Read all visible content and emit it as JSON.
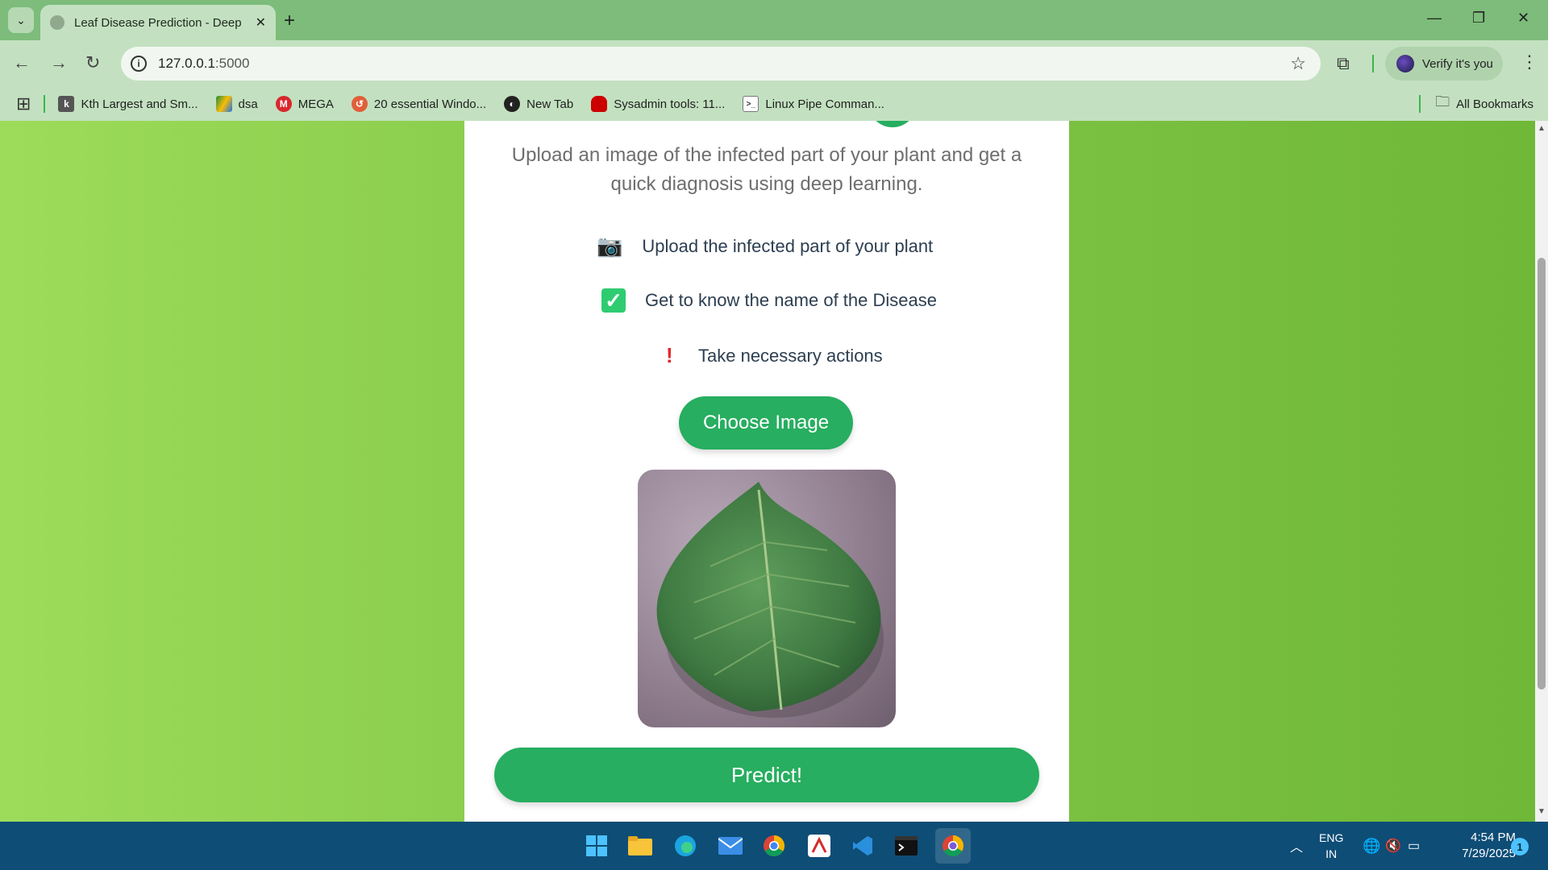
{
  "browser": {
    "tab_title": "Leaf Disease Prediction - Deep Learning",
    "new_tab": "+",
    "url_host": "127.0.0.1",
    "url_port": ":5000",
    "verify_label": "Verify it's you",
    "bookmarks": [
      {
        "label": "Kth Largest and Sm..."
      },
      {
        "label": "dsa"
      },
      {
        "label": "MEGA"
      },
      {
        "label": "20 essential Windo..."
      },
      {
        "label": "New Tab"
      },
      {
        "label": "Sysadmin tools: 11..."
      },
      {
        "label": "Linux Pipe Comman..."
      }
    ],
    "all_bookmarks": "All Bookmarks"
  },
  "page": {
    "subtitle": "Upload an image of the infected part of your plant and get a quick diagnosis using deep learning.",
    "features": [
      {
        "icon": "camera-icon",
        "glyph": "📷",
        "text": "Upload the infected part of your plant"
      },
      {
        "icon": "check-icon",
        "glyph": "✓",
        "text": "Get to know the name of the Disease"
      },
      {
        "icon": "exclamation-icon",
        "glyph": "!",
        "text": "Take necessary actions"
      }
    ],
    "choose_button": "Choose Image",
    "predict_button": "Predict!"
  },
  "taskbar": {
    "lang_top": "ENG",
    "lang_bottom": "IN",
    "time": "4:54 PM",
    "date": "7/29/2025",
    "notifications": "1"
  },
  "colors": {
    "accent": "#27ae60",
    "check": "#2ecc71",
    "warning": "#e0282a"
  }
}
